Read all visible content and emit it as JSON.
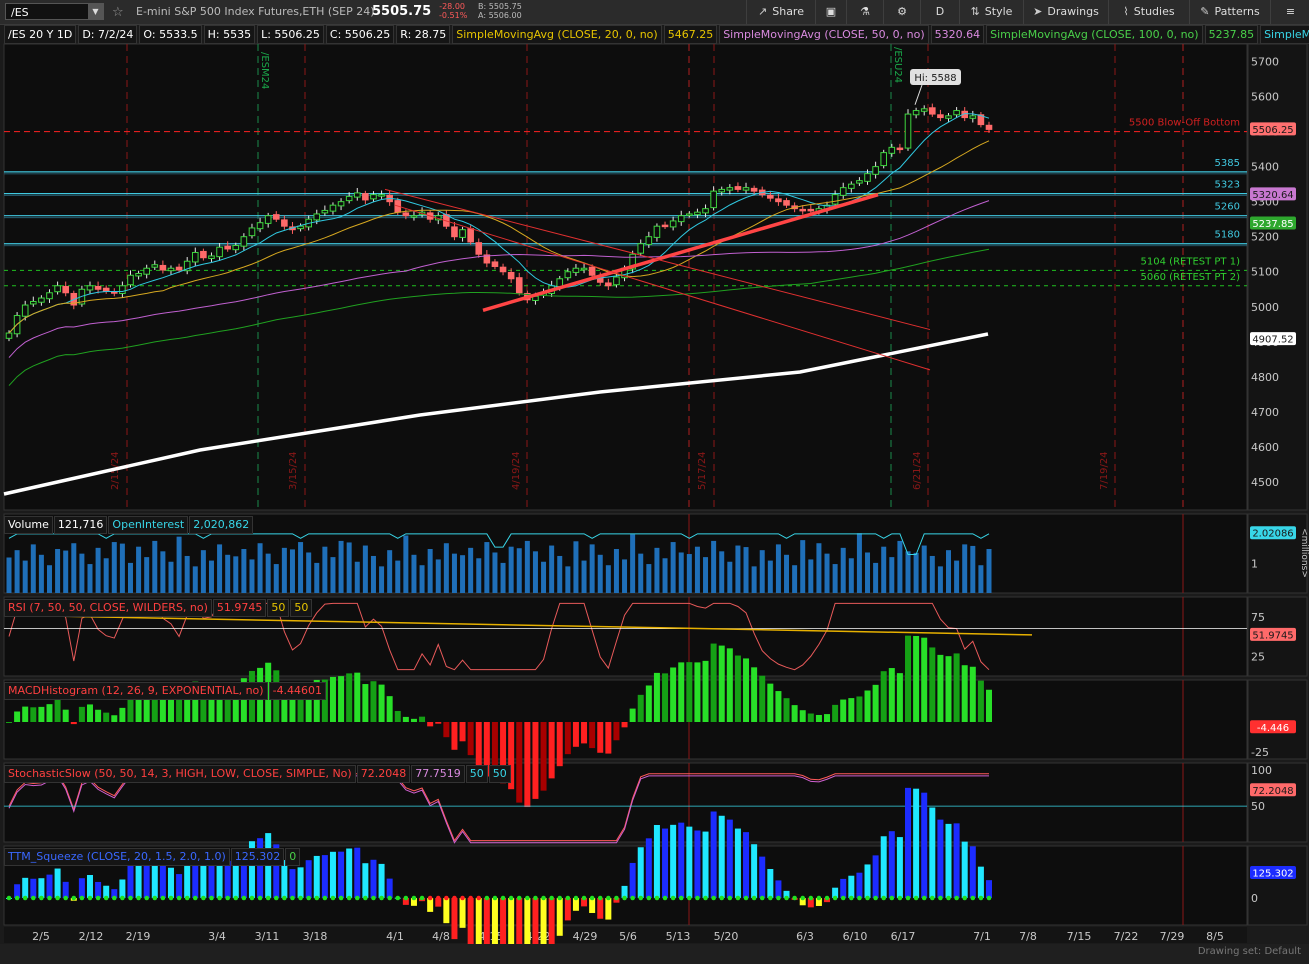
{
  "toolbar": {
    "symbol": "/ES",
    "description": "E-mini S&P 500 Index Futures,ETH (SEP 24)",
    "last": "5505.75",
    "change": "-28.00",
    "change_pct": "-0.51%",
    "bid": "B: 5505.75",
    "ask": "A: 5506.00",
    "share": "Share",
    "period": "D",
    "style": "Style",
    "drawings": "Drawings",
    "studies": "Studies",
    "patterns": "Patterns"
  },
  "studybar": {
    "symbol_period": "/ES 20 Y 1D",
    "date": "D: 7/2/24",
    "open": "O: 5533.5",
    "high": "H: 5535",
    "low": "L: 5506.25",
    "close": "C: 5506.25",
    "range": "R: 28.75",
    "sma20": "SimpleMovingAvg (CLOSE, 20, 0, no)",
    "sma20_val": "5467.25",
    "sma50": "SimpleMovingAvg (CLOSE, 50, 0, no)",
    "sma50_val": "5320.64",
    "sma100": "SimpleMovingAvg (CLOSE, 100, 0, no)",
    "sma100_val": "5237.85",
    "sma_more": "SimpleMoving..."
  },
  "chart_data": {
    "type": "candlestick",
    "price_axis": {
      "ticks": [
        5700,
        5600,
        5500,
        5400,
        5300,
        5200,
        5100,
        5000,
        4900,
        4800,
        4700,
        4600,
        4500
      ],
      "ylim": [
        4420,
        5750
      ]
    },
    "x_ticks": [
      "2/5",
      "2/12",
      "2/19",
      "3/4",
      "3/11",
      "3/18",
      "4/1",
      "4/8",
      "4/15",
      "4/22",
      "4/29",
      "5/6",
      "5/13",
      "5/20",
      "6/3",
      "6/10",
      "6/17",
      "7/1",
      "7/8",
      "7/15",
      "7/22",
      "7/29",
      "8/5"
    ],
    "closes": [
      4925,
      4975,
      5005,
      5015,
      5025,
      5040,
      5060,
      5040,
      5005,
      5050,
      5060,
      5050,
      5045,
      5040,
      5060,
      5090,
      5095,
      5110,
      5120,
      5105,
      5110,
      5105,
      5130,
      5155,
      5140,
      5145,
      5170,
      5165,
      5175,
      5200,
      5225,
      5240,
      5260,
      5250,
      5230,
      5220,
      5230,
      5250,
      5265,
      5275,
      5290,
      5300,
      5315,
      5325,
      5305,
      5320,
      5320,
      5300,
      5270,
      5260,
      5260,
      5270,
      5250,
      5260,
      5230,
      5200,
      5220,
      5185,
      5150,
      5125,
      5115,
      5100,
      5080,
      5040,
      5020,
      5030,
      5040,
      5060,
      5080,
      5100,
      5110,
      5110,
      5090,
      5070,
      5060,
      5085,
      5110,
      5150,
      5180,
      5200,
      5230,
      5230,
      5245,
      5260,
      5265,
      5270,
      5280,
      5330,
      5335,
      5340,
      5335,
      5340,
      5330,
      5320,
      5310,
      5300,
      5290,
      5280,
      5275,
      5275,
      5280,
      5290,
      5320,
      5340,
      5350,
      5360,
      5380,
      5400,
      5440,
      5455,
      5450,
      5550,
      5560,
      5565,
      5550,
      5540,
      5545,
      5560,
      5540,
      5545,
      5520,
      5506.25
    ],
    "levels": [
      {
        "label": "5500 Blow-Off Bottom",
        "value": 5500,
        "color": "#ff2020"
      },
      {
        "label": "5385",
        "value": 5385,
        "color": "#40c8e0"
      },
      {
        "label": "5323",
        "value": 5323,
        "color": "#40c8e0"
      },
      {
        "label": "5260",
        "value": 5260,
        "color": "#40c8e0"
      },
      {
        "label": "5180",
        "value": 5180,
        "color": "#40c8e0"
      },
      {
        "label": "5104 (RETEST PT 1)",
        "value": 5104,
        "color": "#20c020"
      },
      {
        "label": "5060 (RETEST PT 2)",
        "value": 5060,
        "color": "#20c020"
      }
    ],
    "price_labels": [
      {
        "text": "5506.25",
        "value": 5506.25,
        "bg": "#ff7070",
        "fg": "#1a1a1a"
      },
      {
        "text": "5320.64",
        "value": 5320.64,
        "bg": "#c878d0",
        "fg": "#1a1a1a"
      },
      {
        "text": "5237.85",
        "value": 5237.85,
        "bg": "#2ea82e",
        "fg": "#ffffff"
      },
      {
        "text": "4907.52",
        "value": 4907.52,
        "bg": "#ffffff",
        "fg": "#1a1a1a"
      }
    ],
    "annotations": {
      "hi": "Hi: 5588",
      "hi_value": 5588,
      "contract_labels": [
        "/ESM24",
        "/ESU24"
      ],
      "date_markers": [
        "2/15/24",
        "3/15/24",
        "4/19/24",
        "5/17/24",
        "6/21/24",
        "7/19/24"
      ]
    },
    "volume": {
      "title": "Volume",
      "value": "121,716",
      "oi_title": "OpenInterest",
      "oi_value": "2,020,862",
      "label": "2.02086",
      "unit": "<millions>",
      "ticks": [
        "2",
        "1"
      ]
    },
    "rsi": {
      "title": "RSI (7, 50, 50, CLOSE, WILDERS, no)",
      "value": "51.9745",
      "ob": "50",
      "os": "50",
      "label": "51.9745",
      "ticks": [
        "75",
        "25"
      ]
    },
    "macd": {
      "title": "MACDHistogram (12, 26, 9, EXPONENTIAL, no)",
      "value": "-4.44601",
      "label": "-4.446",
      "ticks": [
        "-25"
      ]
    },
    "stoch": {
      "title": "StochasticSlow (50, 50, 14, 3, HIGH, LOW, CLOSE, SIMPLE, No)",
      "k": "72.2048",
      "d": "77.7519",
      "ob": "50",
      "os": "50",
      "label": "72.2048",
      "ticks": [
        "100",
        "50"
      ]
    },
    "ttm": {
      "title": "TTM_Squeeze (CLOSE, 20, 1.5, 2.0, 1.0)",
      "value": "125.302",
      "zero": "0",
      "label": "125.302",
      "ticks": [
        "0"
      ]
    }
  },
  "footer": {
    "drawing_set": "Drawing set: Default"
  }
}
